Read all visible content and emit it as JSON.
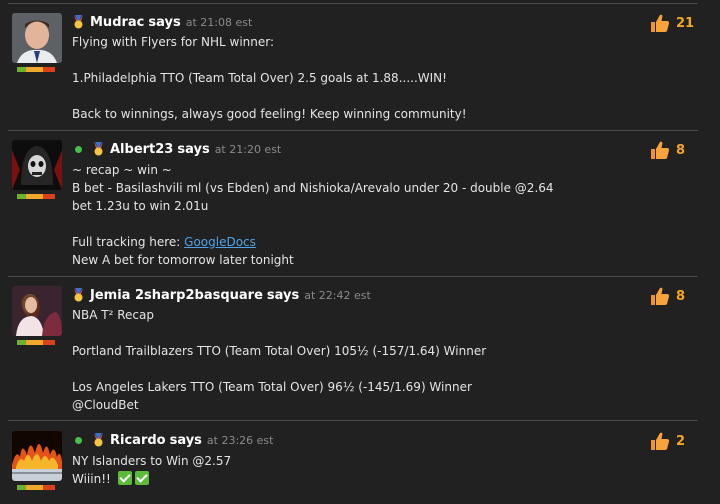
{
  "posts": [
    {
      "username": "Mudrac",
      "says": "says",
      "time": "at 21:08 est",
      "online": false,
      "likes": "21",
      "lines": [
        "Flying with Flyers for NHL winner:",
        "",
        "1.Philadelphia TTO (Team Total Over) 2.5 goals at 1.88.....WIN!",
        "",
        "Back to winnings, always good feeling! Keep winning community!"
      ]
    },
    {
      "username": "Albert23",
      "says": "says",
      "time": "at 21:20 est",
      "online": true,
      "likes": "8",
      "lines": [
        "~ recap ~ win ~",
        "B bet - Basilashvili ml (vs Ebden) and Nishioka/Arevalo under 20 - double @2.64",
        "bet 1.23u to win 2.01u",
        ""
      ],
      "link_prefix": "Full tracking here: ",
      "link_text": "GoogleDocs",
      "last_line": "New A bet for tomorrow later tonight"
    },
    {
      "username": "Jemia 2sharp2basquare",
      "says": "says",
      "time": "at 22:42 est",
      "online": false,
      "likes": "8",
      "lines": [
        "NBA T² Recap",
        "",
        "Portland Trailblazers TTO (Team Total Over) 105½ (-157/1.64) Winner",
        "",
        "Los Angeles Lakers TTO (Team Total Over) 96½ (-145/1.69) Winner",
        "@CloudBet"
      ]
    },
    {
      "username": "Ricardo",
      "says": "says",
      "time": "at 23:26 est",
      "online": true,
      "likes": "2",
      "lines": [
        "NY Islanders to Win @2.57"
      ],
      "last_line": "Wiiin!!"
    }
  ]
}
